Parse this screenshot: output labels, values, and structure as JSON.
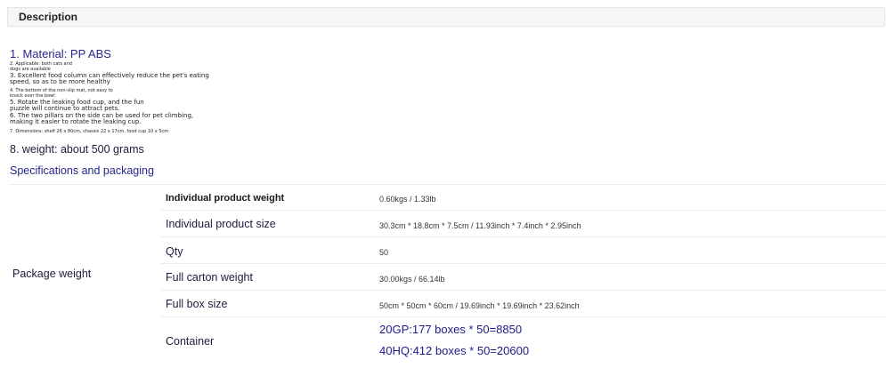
{
  "description": {
    "title": "Description"
  },
  "material": "1. Material: PP ABS",
  "notes": [
    "2. Applicable: both cats and",
    "dogs are available",
    "3. Excellent food column can effectively reduce the pet's eating",
    "speed, so as to be more healthy",
    "4. The bottom of the non-slip mat, not easy to",
    "knock over the bowl",
    "5. Rotate the leaking food cup, and the fun",
    "puzzle will continue to attract pets.",
    "6. The two pillars on the side can be used for pet climbing,",
    "making it easier to rotate the leaking cup.",
    "7. Dimensions: shelf 26 x 80cm, chassis 22 x 17cm, food cup 10 x 5cm"
  ],
  "weight_line": "8. weight: about 500 grams",
  "spec_heading": "Specifications and packaging",
  "package_label": "Package weight",
  "rows": [
    {
      "label": "Individual product weight",
      "value": "0.60kgs / 1.33lb"
    },
    {
      "label": "Individual product size",
      "value": "30.3cm * 18.8cm * 7.5cm / 11.93inch * 7.4inch * 2.95inch"
    },
    {
      "label": "Qty",
      "value": "50"
    },
    {
      "label": "Full carton weight",
      "value": "30.00kgs / 66.14lb"
    },
    {
      "label": "Full box size",
      "value": "50cm * 50cm * 60cm / 19.69inch * 19.69inch * 23.62inch"
    },
    {
      "label": "Container",
      "value": "20GP:177 boxes * 50=8850",
      "value2": "40HQ:412 boxes * 50=20600"
    }
  ]
}
